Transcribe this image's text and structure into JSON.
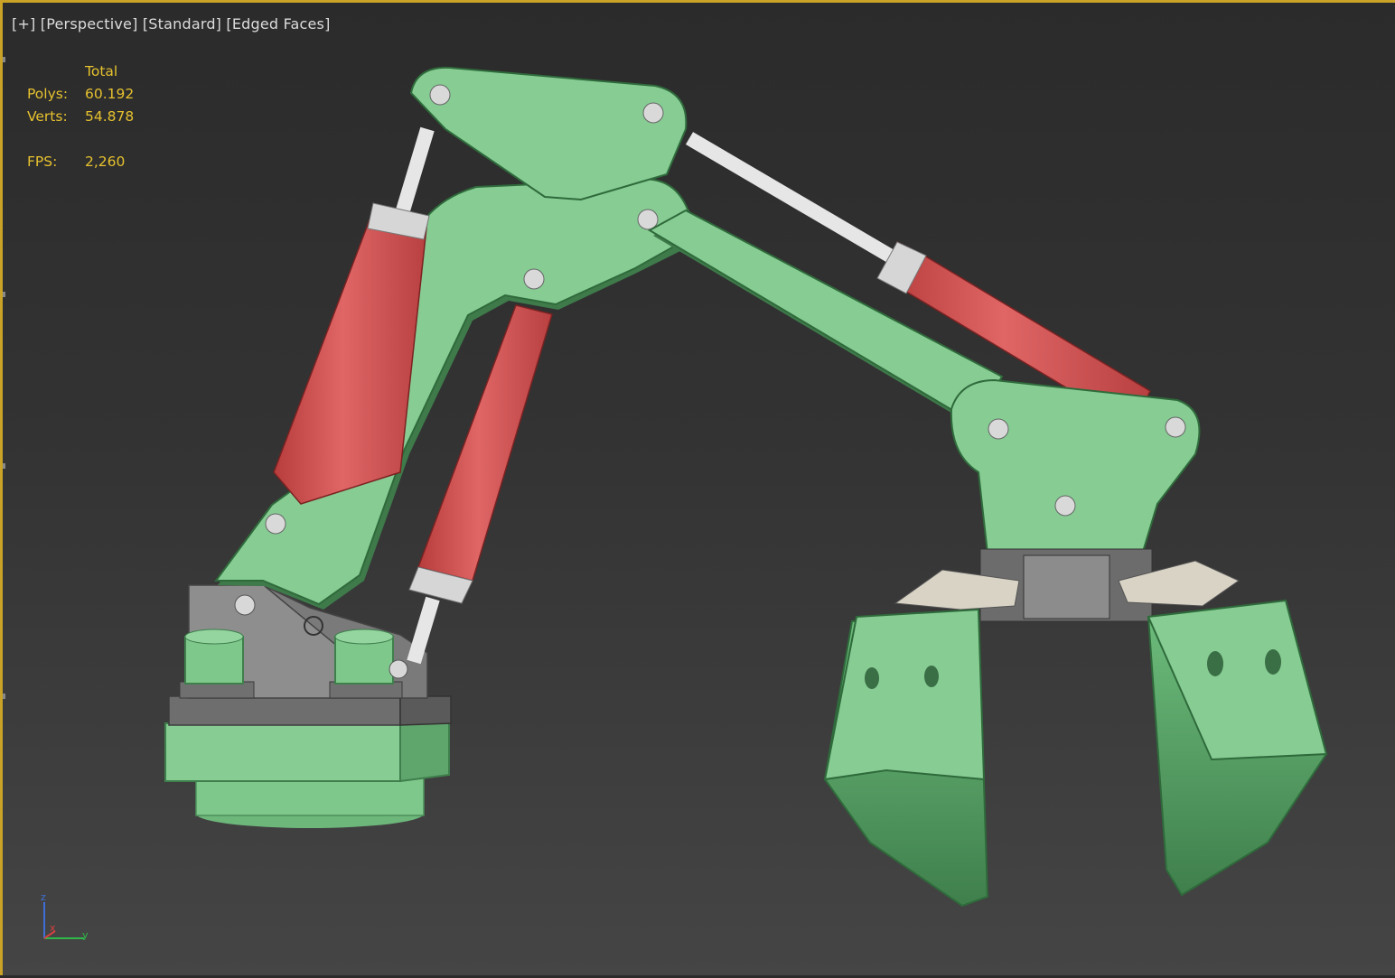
{
  "viewport": {
    "label_plus": "[+]",
    "label_view": "[Perspective]",
    "label_shading": "[Standard]",
    "label_mode": "[Edged Faces]"
  },
  "stats": {
    "header": "Total",
    "polys_label": "Polys:",
    "polys_value": "60.192",
    "verts_label": "Verts:",
    "verts_value": "54.878",
    "fps_label": "FPS:",
    "fps_value": "2,260"
  },
  "axis": {
    "z": "z",
    "x": "x",
    "y": "y"
  },
  "colors": {
    "frame_highlight": "#c9a227",
    "stat_text": "#e6c12e",
    "arm_green": "#87cc94",
    "cylinder_red": "#d95555",
    "rod_white": "#e6e6e6",
    "base_gray": "#8a8a8a"
  }
}
